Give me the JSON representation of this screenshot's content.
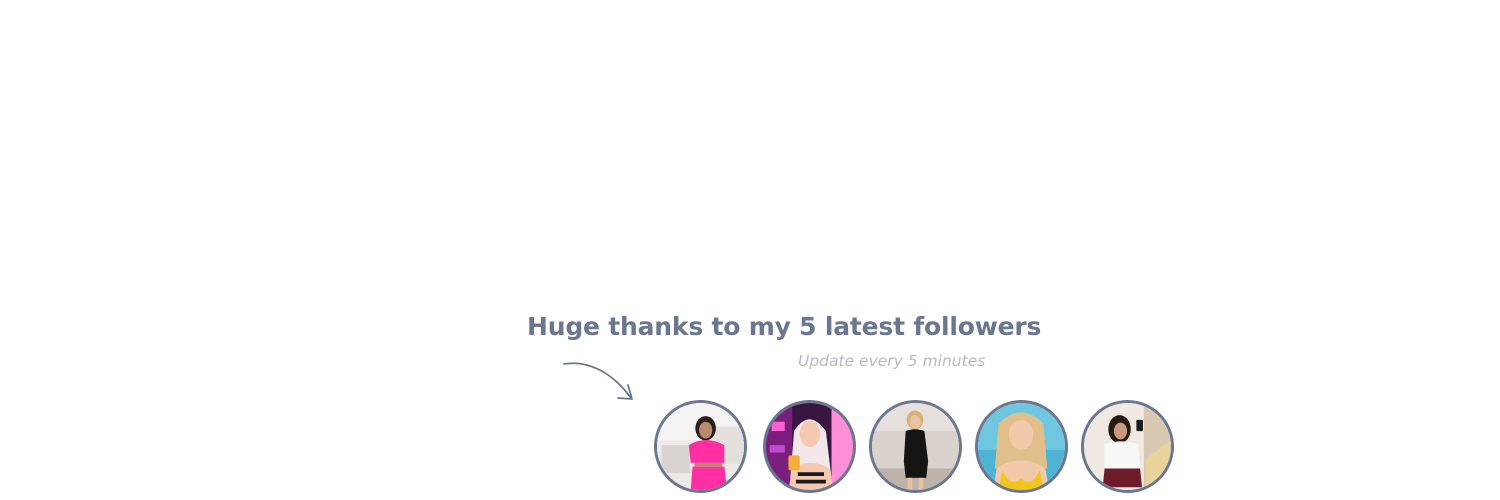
{
  "headline": "Huge thanks to my 5 latest followers",
  "subline": "Update every 5 minutes",
  "colors": {
    "accent": "#6b7790",
    "subtle": "#b5bac6",
    "background": "#ffffff"
  },
  "icons": {
    "pointer": "curved-arrow-icon"
  },
  "followers": [
    {
      "avatar": "follower-avatar-1"
    },
    {
      "avatar": "follower-avatar-2"
    },
    {
      "avatar": "follower-avatar-3"
    },
    {
      "avatar": "follower-avatar-4"
    },
    {
      "avatar": "follower-avatar-5"
    }
  ]
}
